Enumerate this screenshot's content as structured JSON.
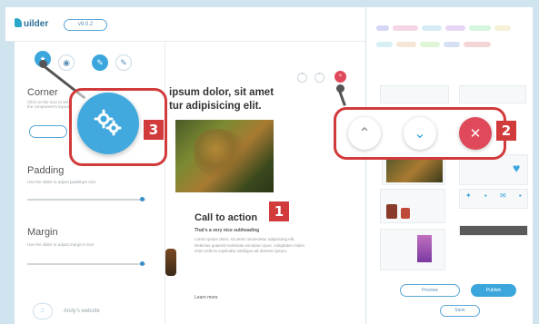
{
  "app": {
    "logo_text": "uilder",
    "top_pill": "v9.0.2"
  },
  "left_panel": {
    "section1": {
      "title": "Corner",
      "hint": "Click on the icon to set the component's layout"
    },
    "padding": {
      "title": "Padding",
      "hint": "Use the slider to adjust padding's size",
      "value": 0.88
    },
    "margin": {
      "title": "Margin",
      "hint": "Use the slider to adjust margin's size",
      "value": 0.88
    },
    "bottom_pill": "::",
    "bottom_text": "Andy's website"
  },
  "canvas": {
    "headline_line1": "ipsum dolor, sit amet",
    "headline_line2": "tur adipisicing elit.",
    "cta_title": "Call to action",
    "cta_subtitle": "That's a very nice subheading",
    "cta_body": "Lorem ipsum dolor, sit amet consectetur adipisicing elit. Delectus quaerat molestias excepturi quos, voluptates minim enim velit ex explicabo similique ad dolorem ipsum.",
    "cta_link": "Learn more"
  },
  "right_panel": {
    "tag_colors": [
      "#d6d6f5",
      "#f5d6e6",
      "#d6ecf5",
      "#e6d6f5",
      "#d6f5e0",
      "#f5f0d6",
      "#d6f0f5",
      "#f5e6d6",
      "#e0f5d6",
      "#d6e0f5",
      "#f5d6d6"
    ],
    "btn_outline": "Preview",
    "btn_filled": "Publish",
    "btn_small": "Save"
  },
  "callouts": {
    "gear_badge": "3",
    "controls_badge": "2",
    "canvas_badge": "1",
    "up_icon": "⌃",
    "down_icon": "⌄",
    "close_icon": "✕"
  }
}
